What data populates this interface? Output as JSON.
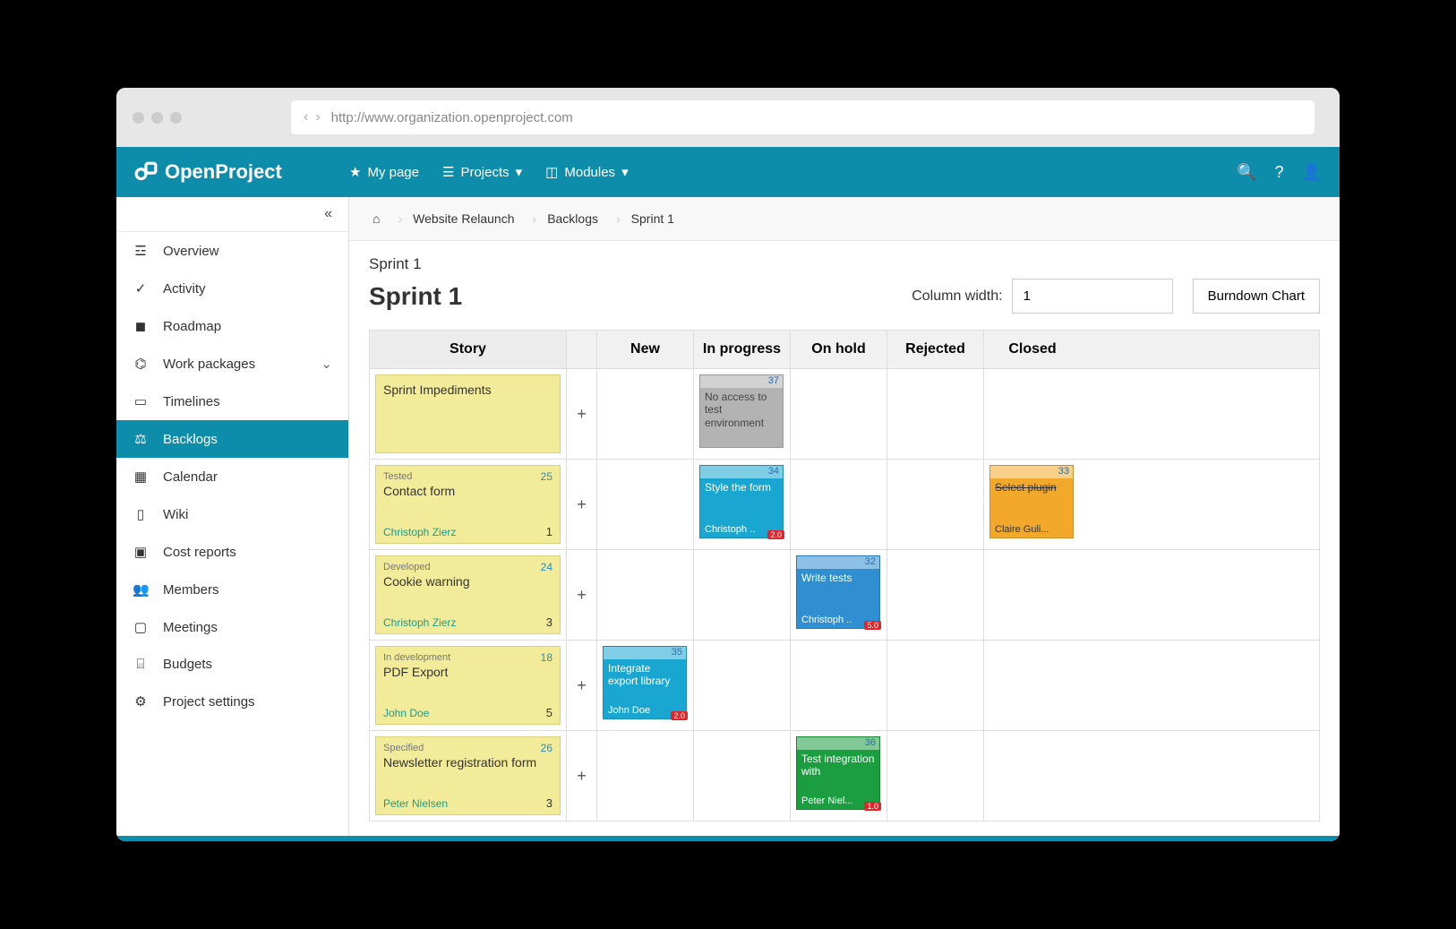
{
  "url": "http://www.organization.openproject.com",
  "brand": "OpenProject",
  "topnav": {
    "my_page": "My page",
    "projects": "Projects",
    "modules": "Modules"
  },
  "sidebar": {
    "items": [
      {
        "label": "Overview"
      },
      {
        "label": "Activity"
      },
      {
        "label": "Roadmap"
      },
      {
        "label": "Work packages"
      },
      {
        "label": "Timelines"
      },
      {
        "label": "Backlogs"
      },
      {
        "label": "Calendar"
      },
      {
        "label": "Wiki"
      },
      {
        "label": "Cost reports"
      },
      {
        "label": "Members"
      },
      {
        "label": "Meetings"
      },
      {
        "label": "Budgets"
      },
      {
        "label": "Project settings"
      }
    ]
  },
  "breadcrumb": {
    "project": "Website Relaunch",
    "module": "Backlogs",
    "page": "Sprint 1"
  },
  "page": {
    "pre": "Sprint 1",
    "title": "Sprint 1"
  },
  "column_width": {
    "label": "Column width:",
    "value": "1"
  },
  "burndown_label": "Burndown Chart",
  "columns": {
    "story": "Story",
    "new": "New",
    "in_progress": "In progress",
    "on_hold": "On hold",
    "rejected": "Rejected",
    "closed": "Closed"
  },
  "rows": [
    {
      "story": {
        "status": "",
        "id": "",
        "title": "Sprint Impediments",
        "assignee": "",
        "points": ""
      },
      "tasks": {
        "in_progress": {
          "id": "37",
          "title": "No access to test environment",
          "assignee": "",
          "badge": "",
          "color": "grey"
        }
      }
    },
    {
      "story": {
        "status": "Tested",
        "id": "25",
        "title": "Contact form",
        "assignee": "Christoph Zierz",
        "points": "1"
      },
      "tasks": {
        "in_progress": {
          "id": "34",
          "title": "Style the form",
          "assignee": "Christoph ..",
          "badge": "2.0",
          "color": "cyan"
        },
        "closed": {
          "id": "33",
          "title": "Select plugin",
          "assignee": "Claire Guli...",
          "badge": "",
          "color": "orange"
        }
      }
    },
    {
      "story": {
        "status": "Developed",
        "id": "24",
        "title": "Cookie warning",
        "assignee": "Christoph Zierz",
        "points": "3"
      },
      "tasks": {
        "on_hold": {
          "id": "32",
          "title": "Write tests",
          "assignee": "Christoph ..",
          "badge": "5.0",
          "color": "blue"
        }
      }
    },
    {
      "story": {
        "status": "In development",
        "id": "18",
        "title": "PDF Export",
        "assignee": "John Doe",
        "points": "5"
      },
      "tasks": {
        "new": {
          "id": "35",
          "title": "Integrate export library",
          "assignee": "John Doe",
          "badge": "2.0",
          "color": "cyan"
        }
      }
    },
    {
      "story": {
        "status": "Specified",
        "id": "26",
        "title": "Newsletter registration form",
        "assignee": "Peter Nielsen",
        "points": "3"
      },
      "tasks": {
        "on_hold": {
          "id": "36",
          "title": "Test integration with",
          "assignee": "Peter Niel...",
          "badge": "1.0",
          "color": "green"
        }
      }
    }
  ]
}
